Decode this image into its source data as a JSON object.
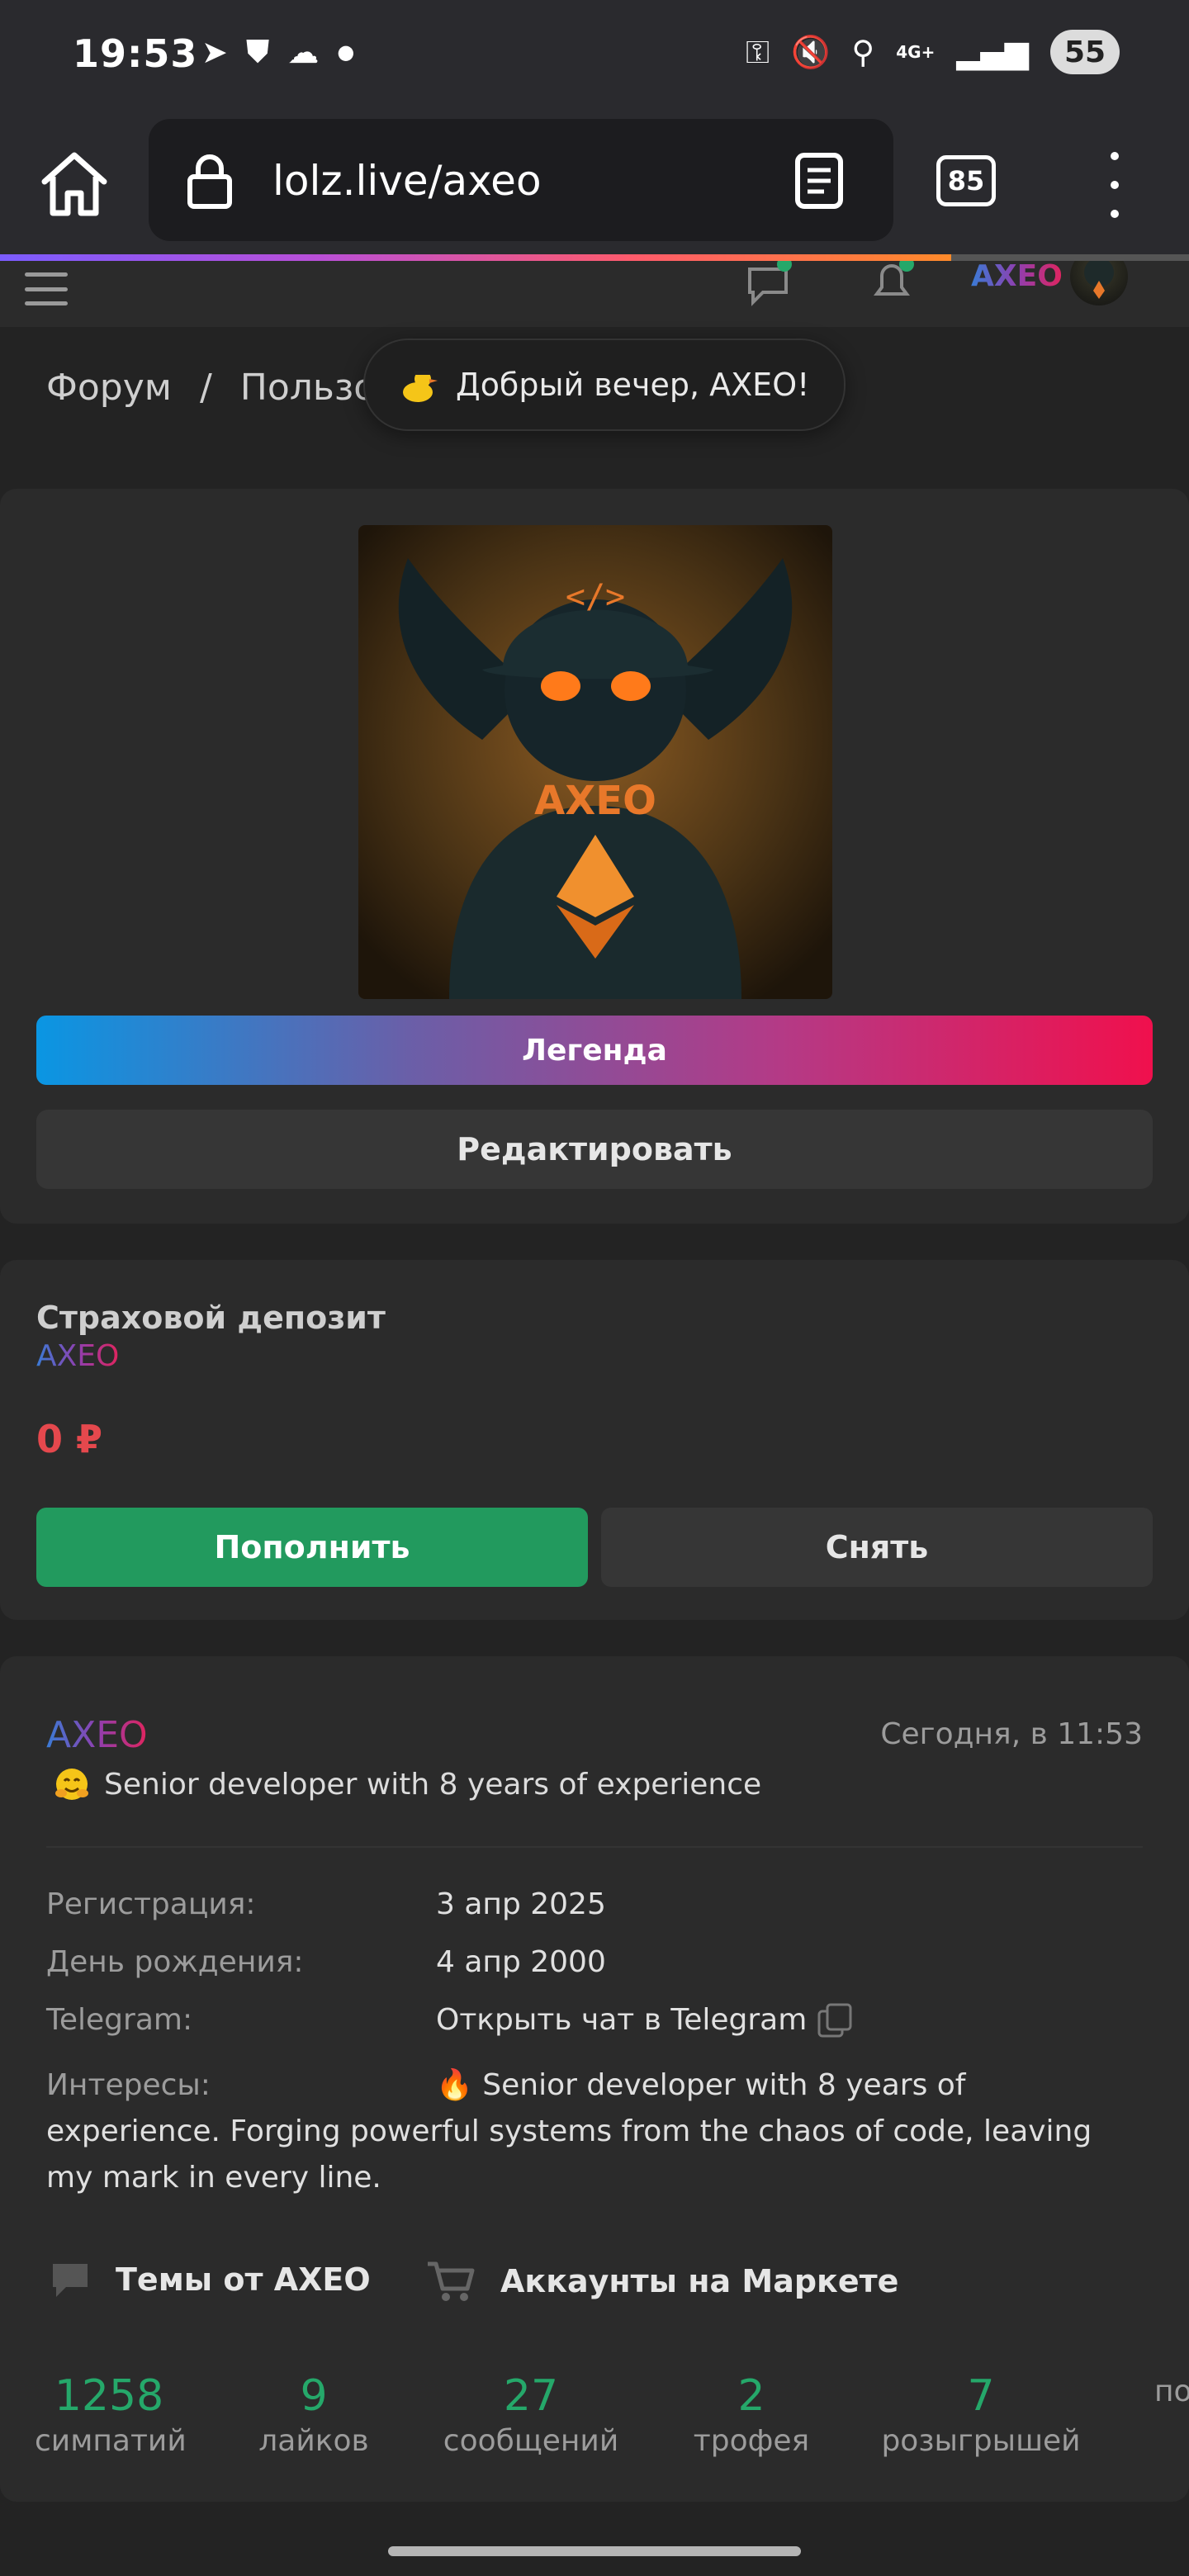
{
  "status_bar": {
    "time": "19:53",
    "network": "4G+",
    "battery": "55"
  },
  "browser": {
    "url": "lolz.live/axeo",
    "tab_count": "85",
    "load_progress": 0.8
  },
  "header": {
    "username": "AXEO"
  },
  "breadcrumb": {
    "items": [
      "Форум",
      "/",
      "Пользо..."
    ]
  },
  "toast": {
    "text": "Добрый вечер, AXEO!"
  },
  "profile_card": {
    "avatar_text": "AXEO",
    "legend_label": "Легенда",
    "edit_label": "Редактировать"
  },
  "deposit": {
    "title": "Страховой депозит",
    "user": "AXEO",
    "amount": "0 ₽",
    "topup_label": "Пополнить",
    "withdraw_label": "Снять"
  },
  "profile_info": {
    "username": "AXEO",
    "last_seen": "Сегодня, в 11:53",
    "status": "Senior developer with 8 years of experience",
    "rows": [
      {
        "label": "Регистрация:",
        "value": "3 апр 2025"
      },
      {
        "label": "День рождения:",
        "value": "4 апр 2000"
      },
      {
        "label": "Telegram:",
        "value": "Открыть чат в Telegram"
      }
    ],
    "interests_label": "Интересы:",
    "interests_value": "🔥 Senior developer with 8 years of experience. Forging powerful systems from the chaos of code, leaving my mark in every line.",
    "topics_link": "Темы от AXEO",
    "market_link": "Аккаунты на Маркете"
  },
  "stats": [
    {
      "num": "1258",
      "label": "симпатий"
    },
    {
      "num": "9",
      "label": "лайков"
    },
    {
      "num": "27",
      "label": "сообщений"
    },
    {
      "num": "2",
      "label": "трофея"
    },
    {
      "num": "7",
      "label": "розыгрышей"
    },
    {
      "num": "",
      "label": "по"
    }
  ],
  "colors": {
    "accent_green": "#25a86a",
    "deposit_red": "#e5484d",
    "legend_gradient": [
      "#0a96e3",
      "#f0104d"
    ]
  }
}
